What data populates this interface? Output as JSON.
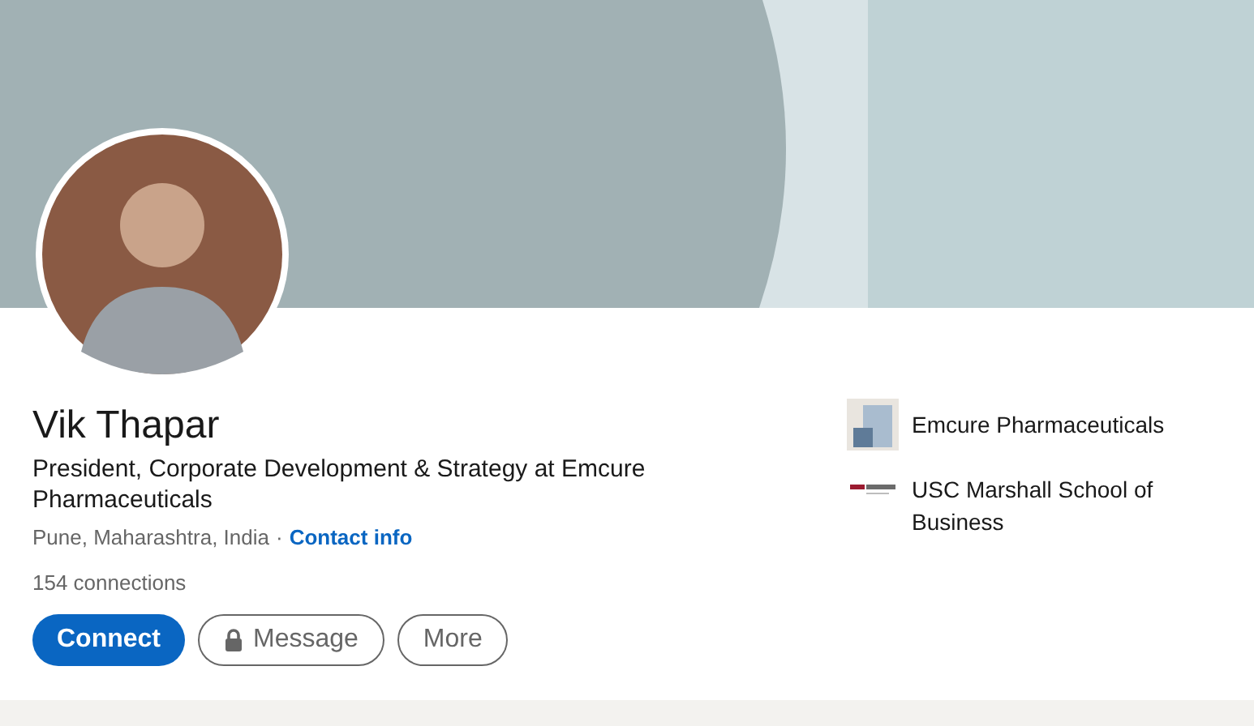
{
  "profile": {
    "name": "Vik Thapar",
    "headline": "President, Corporate Development & Strategy at Emcure Pharmaceuticals",
    "location": "Pune, Maharashtra, India",
    "separator": "·",
    "contact_link": "Contact info",
    "connections": "154 connections"
  },
  "buttons": [
    {
      "label": "Connect",
      "kind": "primary"
    },
    {
      "label": "Message",
      "kind": "locked"
    },
    {
      "label": "More",
      "kind": "outline"
    }
  ],
  "affiliations": [
    {
      "name": "Emcure Pharmaceuticals",
      "kind": "company"
    },
    {
      "name": "USC Marshall School of Business",
      "kind": "school"
    }
  ]
}
